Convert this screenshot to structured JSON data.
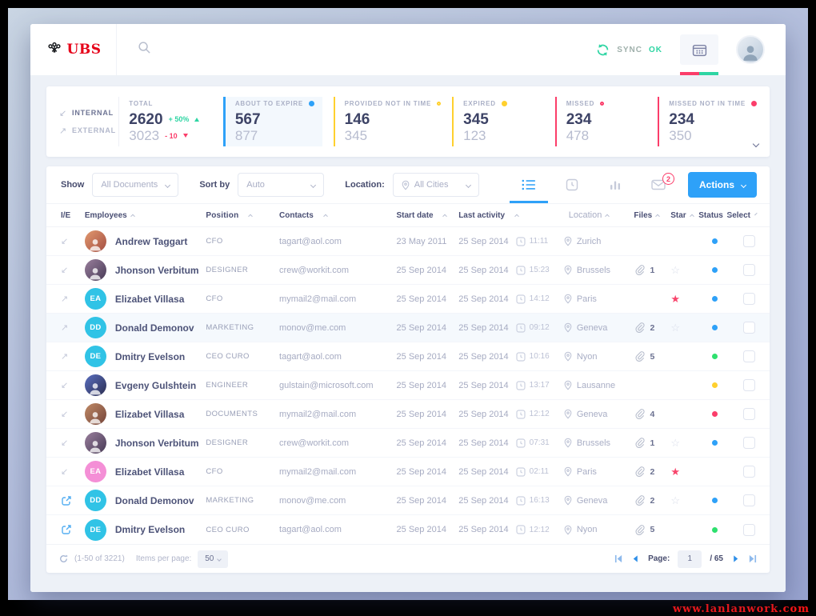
{
  "watermark": "www.lanlanwork.com",
  "header": {
    "brand": "UBS",
    "sync_label": "SYNC",
    "sync_ok": "OK"
  },
  "icons": {
    "star_filled": "★",
    "star_empty": "☆",
    "internal_arrow": "↙",
    "external_arrow": "↗"
  },
  "stats": {
    "internal_label": "INTERNAL",
    "external_label": "EXTERNAL",
    "total": {
      "label": "TOTAL",
      "internal": "2620",
      "internal_delta": "+ 50%",
      "external": "3023",
      "external_delta": "- 10"
    },
    "cards": [
      {
        "label": "ABOUT TO EXPIRE",
        "indicator": "blue-solid",
        "internal": "567",
        "external": "877",
        "accent": "#2ea1f8"
      },
      {
        "label": "PROVIDED NOT IN TIME",
        "indicator": "yellow-hollow",
        "internal": "146",
        "external": "345",
        "accent": "#ffd02e"
      },
      {
        "label": "EXPIRED",
        "indicator": "yellow-solid",
        "internal": "345",
        "external": "123",
        "accent": "#ffd02e"
      },
      {
        "label": "MISSED",
        "indicator": "red-hollow",
        "internal": "234",
        "external": "478",
        "accent": "#fb3d6a"
      },
      {
        "label": "MISSED NOT IN TIME",
        "indicator": "red-solid",
        "internal": "234",
        "external": "350",
        "accent": "#fb3d6a"
      }
    ]
  },
  "toolbar": {
    "show_label": "Show",
    "show_value": "All Documents",
    "sort_label": "Sort by",
    "sort_value": "Auto",
    "location_label": "Location:",
    "location_value": "All Cities",
    "mail_badge": "2",
    "actions_label": "Actions"
  },
  "table": {
    "headers": {
      "ie": "I/E",
      "employees": "Employees",
      "position": "Position",
      "contacts": "Contacts",
      "start": "Start date",
      "activity": "Last activity",
      "location": "Location",
      "files": "Files",
      "star": "Star",
      "status": "Status",
      "select": "Select"
    },
    "rows": [
      {
        "ie": "internal",
        "avatar": "photo",
        "name": "Andrew Taggart",
        "position": "CFO",
        "email": "tagart@aol.com",
        "start": "23 May 2011",
        "activity_date": "25 Sep 2014",
        "activity_time": "11:11",
        "city": "Zurich",
        "files": "",
        "star": "none",
        "status": "blue"
      },
      {
        "ie": "internal",
        "avatar": "photo",
        "name": "Jhonson Verbitum",
        "position": "DESIGNER",
        "email": "crew@workit.com",
        "start": "25 Sep 2014",
        "activity_date": "25 Sep 2014",
        "activity_time": "15:23",
        "city": "Brussels",
        "files": "1",
        "star": "empty",
        "status": "blue"
      },
      {
        "ie": "external",
        "avatar": "initials",
        "initials": "EA",
        "name": "Elizabet Villasa",
        "position": "CFO",
        "email": "mymail2@mail.com",
        "start": "25 Sep 2014",
        "activity_date": "25 Sep 2014",
        "activity_time": "14:12",
        "city": "Paris",
        "files": "",
        "star": "red",
        "status": "blue"
      },
      {
        "ie": "external",
        "avatar": "initials",
        "initials": "DD",
        "name": "Donald Demonov",
        "position": "MARKETING",
        "email": "monov@me.com",
        "start": "25 Sep 2014",
        "activity_date": "25 Sep 2014",
        "activity_time": "09:12",
        "city": "Geneva",
        "files": "2",
        "star": "empty",
        "status": "blue",
        "highlighted": true
      },
      {
        "ie": "external",
        "avatar": "initials",
        "initials": "DE",
        "name": "Dmitry Evelson",
        "position": "CEO CURO",
        "email": "tagart@aol.com",
        "start": "25 Sep 2014",
        "activity_date": "25 Sep 2014",
        "activity_time": "10:16",
        "city": "Nyon",
        "files": "5",
        "star": "none",
        "status": "green"
      },
      {
        "ie": "internal",
        "avatar": "photo",
        "name": "Evgeny Gulshtein",
        "position": "ENGINEER",
        "email": "gulstain@microsoft.com",
        "start": "25 Sep 2014",
        "activity_date": "25 Sep 2014",
        "activity_time": "13:17",
        "city": "Lausanne",
        "files": "",
        "star": "none",
        "status": "yellow"
      },
      {
        "ie": "internal",
        "avatar": "photo",
        "name": "Elizabet Villasa",
        "position": "DOCUMENTS",
        "email": "mymail2@mail.com",
        "start": "25 Sep 2014",
        "activity_date": "25 Sep 2014",
        "activity_time": "12:12",
        "city": "Geneva",
        "files": "4",
        "star": "none",
        "status": "red"
      },
      {
        "ie": "internal",
        "avatar": "photo",
        "name": "Jhonson Verbitum",
        "position": "DESIGNER",
        "email": "crew@workit.com",
        "start": "25 Sep 2014",
        "activity_date": "25 Sep 2014",
        "activity_time": "07:31",
        "city": "Brussels",
        "files": "1",
        "star": "empty",
        "status": "blue"
      },
      {
        "ie": "internal",
        "avatar": "initials",
        "initials": "EA",
        "name": "Elizabet Villasa",
        "position": "CFO",
        "email": "mymail2@mail.com",
        "start": "25 Sep 2014",
        "activity_date": "25 Sep 2014",
        "activity_time": "02:11",
        "city": "Paris",
        "files": "2",
        "star": "red",
        "status": "none"
      },
      {
        "ie": "link",
        "avatar": "initials",
        "initials": "DD",
        "name": "Donald Demonov",
        "position": "MARKETING",
        "email": "monov@me.com",
        "start": "25 Sep 2014",
        "activity_date": "25 Sep 2014",
        "activity_time": "16:13",
        "city": "Geneva",
        "files": "2",
        "star": "empty",
        "status": "blue"
      },
      {
        "ie": "link",
        "avatar": "initials",
        "initials": "DE",
        "name": "Dmitry Evelson",
        "position": "CEO CURO",
        "email": "tagart@aol.com",
        "start": "25 Sep 2014",
        "activity_date": "25 Sep 2014",
        "activity_time": "12:12",
        "city": "Nyon",
        "files": "5",
        "star": "none",
        "status": "green"
      }
    ]
  },
  "footer": {
    "range": "(1-50 of 3221)",
    "per_page_label": "Items per page:",
    "per_page": "50",
    "page_label": "Page:",
    "page": "1",
    "total_pages": "/ 65"
  }
}
